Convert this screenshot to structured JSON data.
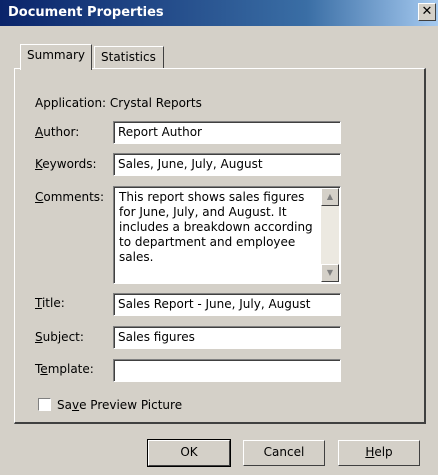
{
  "window": {
    "title": "Document Properties",
    "close_glyph": "✕"
  },
  "tabs": [
    {
      "label": "Summary",
      "active": true
    },
    {
      "label": "Statistics",
      "active": false
    }
  ],
  "summary": {
    "application_label": "Application:",
    "application_value": "Crystal Reports",
    "author": {
      "pre": "",
      "u": "A",
      "post": "uthor:",
      "value": "Report Author"
    },
    "keywords": {
      "pre": "",
      "u": "K",
      "post": "eywords:",
      "value": "Sales, June, July, August"
    },
    "comments": {
      "pre": "",
      "u": "C",
      "post": "omments:",
      "value": "This report shows sales figures for June, July, and August. It includes a breakdown according to department and employee sales."
    },
    "title": {
      "pre": "",
      "u": "T",
      "post": "itle:",
      "value": "Sales Report - June, July, August"
    },
    "subject": {
      "pre": "",
      "u": "S",
      "post": "ubject:",
      "value": "Sales figures"
    },
    "template": {
      "pre": "T",
      "u": "e",
      "post": "mplate:",
      "value": ""
    },
    "save_preview": {
      "pre": "Sa",
      "u": "v",
      "post": "e Preview Picture",
      "checked": false
    }
  },
  "buttons": {
    "ok": "OK",
    "cancel": "Cancel",
    "help_u": "H",
    "help_rest": "elp"
  },
  "icons": {
    "scroll_up": "scroll-up-arrow-icon",
    "scroll_down": "scroll-down-arrow-icon",
    "close": "close-icon"
  }
}
